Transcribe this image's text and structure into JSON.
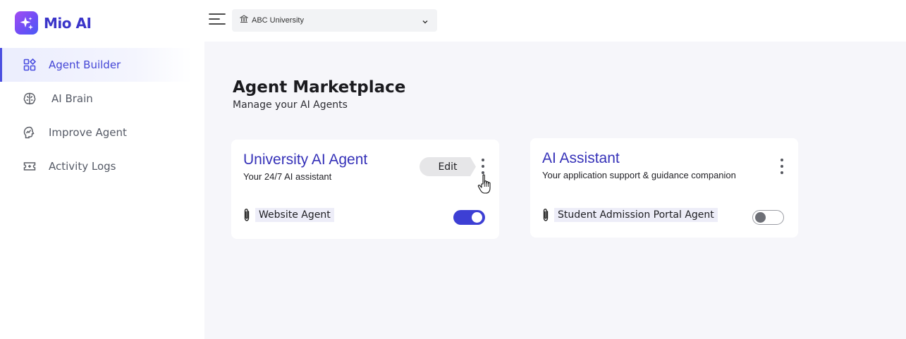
{
  "brand": {
    "name": "Mio AI",
    "logo_icon": "sparkle-icon"
  },
  "sidebar": {
    "items": [
      {
        "label": "Agent Builder",
        "icon": "grid-apps-icon",
        "active": true
      },
      {
        "label": "AI Brain",
        "icon": "brain-icon",
        "active": false
      },
      {
        "label": "Improve Agent",
        "icon": "chart-up-icon",
        "active": false
      },
      {
        "label": "Activity Logs",
        "icon": "ticket-icon",
        "active": false
      }
    ]
  },
  "header": {
    "menu_icon": "hamburger-menu-icon",
    "org_select": {
      "value": "ABC University",
      "icon": "institution-icon"
    }
  },
  "main": {
    "title": "Agent Marketplace",
    "subtitle": "Manage your AI Agents",
    "cards": [
      {
        "title": "University AI Agent",
        "description": "Your 24/7 AI assistant",
        "edit_label": "Edit",
        "tag": "Website Agent",
        "enabled": true
      },
      {
        "title": "AI Assistant",
        "description": "Your application support & guidance companion",
        "tag": "Student Admission Portal Agent",
        "enabled": false
      }
    ]
  },
  "colors": {
    "accent": "#3d3fd4",
    "card_title": "#3531b8",
    "main_background": "#f6f6fa"
  }
}
